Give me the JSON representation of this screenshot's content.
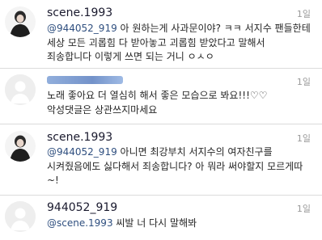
{
  "comments": [
    {
      "username": "scene.1993",
      "time": "1일",
      "mention": "@944052_919",
      "text": " 아 원하는게 사과문이야? ㅋㅋ 서지수 팬들한테 세상 모든 괴롭힘 다 받아놓고 괴롭힘 받았다고 말해서 죄송합니다 이렇게 쓰면 되는 거니 ㅇㅅㅇ",
      "avatar": "person-silhouette-icon"
    },
    {
      "username": "",
      "time": "1일",
      "mention": "",
      "text": "노래 좋아요 더 열심히 해서 좋은 모습으로 봐요!!!♡♡ 악성댓글은 상관쓰지마세요",
      "avatar": "default-avatar-icon"
    },
    {
      "username": "scene.1993",
      "time": "1일",
      "mention": "@944052_919",
      "text": " 아니면 최강부치 서지수의 여자친구를 시켜줬음에도 싫다해서 죄송합니다? 아 뭐라 써야할지 모르게따~!",
      "avatar": "person-silhouette-icon"
    },
    {
      "username": "944052_919",
      "time": "1일",
      "mention": "@scene.1993",
      "text": " 씨발 너 다시 말해봐",
      "avatar": "default-avatar-icon"
    }
  ]
}
